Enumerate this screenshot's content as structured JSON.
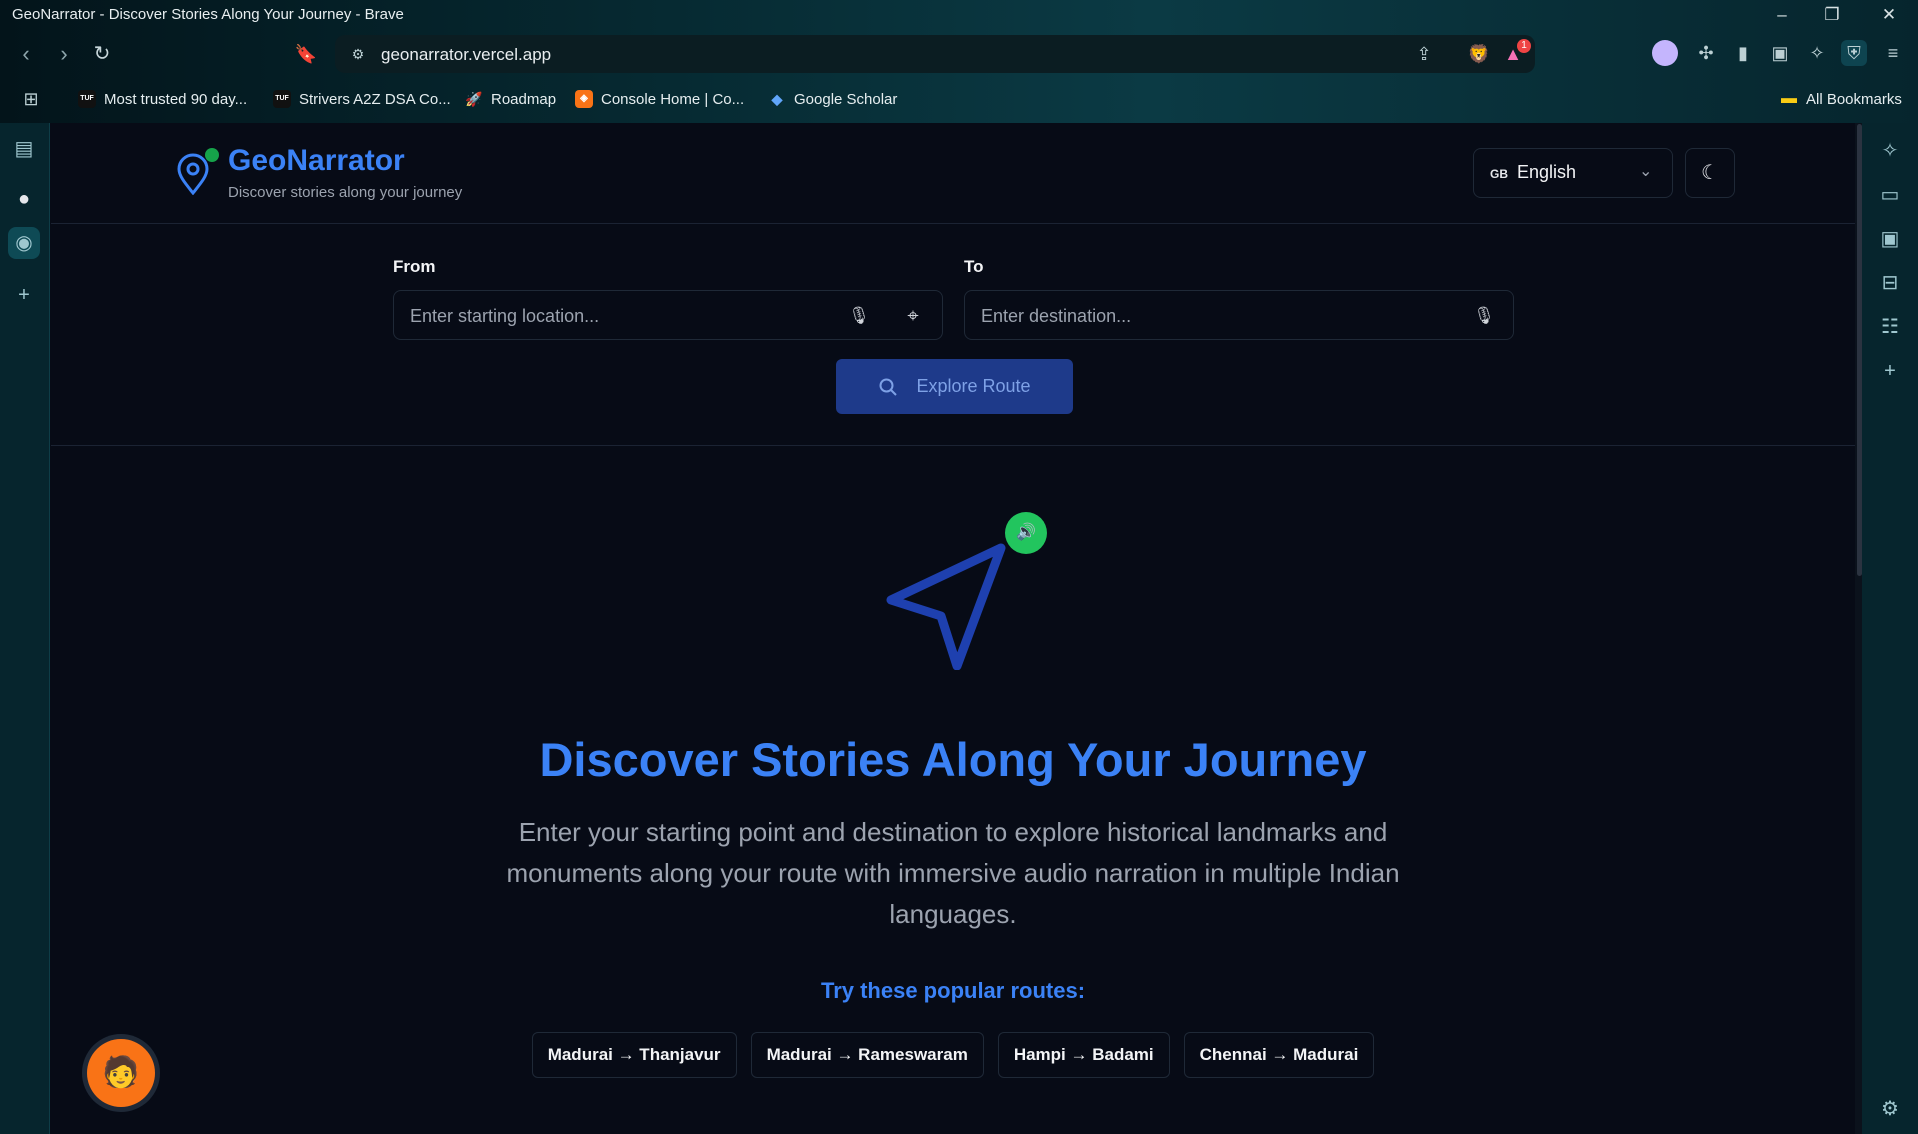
{
  "window": {
    "title": "GeoNarrator - Discover Stories Along Your Journey - Brave"
  },
  "browser": {
    "url": "geonarrator.vercel.app",
    "alert_count": "1",
    "bookmarks": [
      {
        "label": "Most trusted 90 day...",
        "favicon": "TUF"
      },
      {
        "label": "Strivers A2Z DSA Co...",
        "favicon": "TUF"
      },
      {
        "label": "Roadmap",
        "favicon": "rocket"
      },
      {
        "label": "Console Home | Co...",
        "favicon": "cube"
      },
      {
        "label": "Google Scholar",
        "favicon": "cap"
      }
    ],
    "all_bookmarks": "All Bookmarks"
  },
  "app": {
    "brand": "GeoNarrator",
    "tagline": "Discover stories along your journey",
    "language": {
      "code": "GB",
      "name": "English"
    },
    "from": {
      "label": "From",
      "placeholder": "Enter starting location..."
    },
    "to": {
      "label": "To",
      "placeholder": "Enter destination..."
    },
    "explore_label": "Explore Route",
    "hero_title": "Discover Stories Along Your Journey",
    "hero_desc": "Enter your starting point and destination to explore historical landmarks and monuments along your route with immersive audio narration in multiple Indian languages.",
    "popular_title": "Try these popular routes:",
    "routes": [
      "Madurai → Thanjavur",
      "Madurai → Rameswaram",
      "Hampi → Badami",
      "Chennai → Madurai"
    ]
  },
  "colors": {
    "accent": "#3b82f6",
    "button": "#1e3a8a",
    "success": "#22c55e",
    "page_bg": "#070b16"
  }
}
